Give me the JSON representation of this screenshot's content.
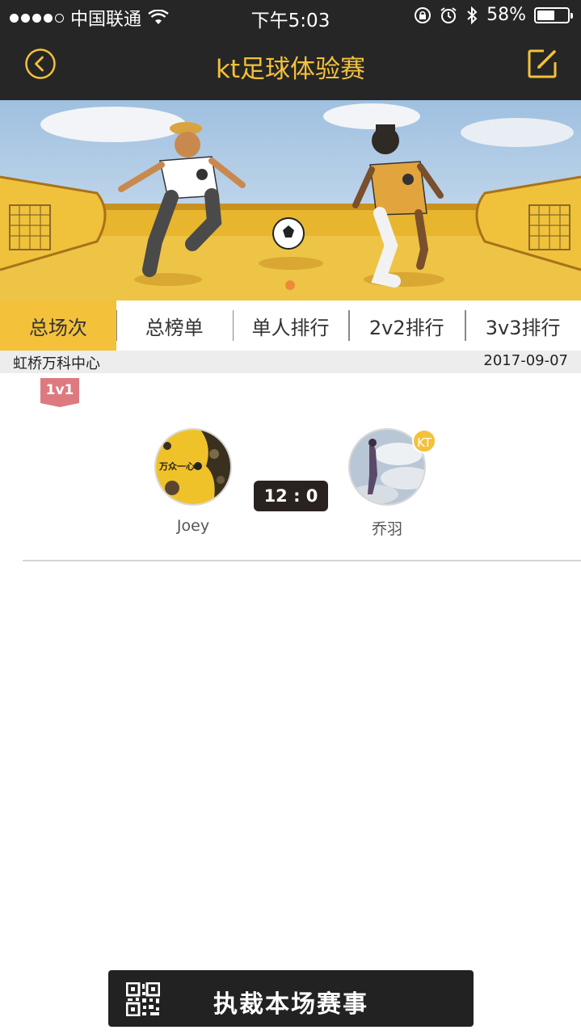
{
  "status_bar": {
    "carrier": "中国联通",
    "time": "下午5:03",
    "battery_percent": "58%",
    "battery_level": 0.58,
    "icons": [
      "signal-dots-icon",
      "wifi-icon",
      "rotation-lock-icon",
      "alarm-icon",
      "bluetooth-icon",
      "battery-icon"
    ]
  },
  "nav": {
    "title": "kt足球体验赛",
    "back_icon": "chevron-left-circle-icon",
    "edit_icon": "edit-icon"
  },
  "banner": {
    "pager_dots": 1,
    "active_dot": 0
  },
  "tabs": [
    {
      "label": "总场次",
      "active": true
    },
    {
      "label": "总榜单",
      "active": false
    },
    {
      "label": "单人排行",
      "active": false
    },
    {
      "label": "2v2排行",
      "active": false
    },
    {
      "label": "3v3排行",
      "active": false
    }
  ],
  "info": {
    "venue": "虹桥万科中心",
    "date": "2017-09-07"
  },
  "match": {
    "mode": "1v1",
    "score": "12 : 0",
    "left_player": {
      "name": "Joey",
      "avatar_text": "万众一心"
    },
    "right_player": {
      "name": "乔羽",
      "badge": "KT"
    }
  },
  "bottom_button": {
    "label": "执裁本场赛事",
    "icon": "qr-code-icon"
  },
  "colors": {
    "accent": "#f3c13a",
    "dark": "#262626",
    "tag": "#dd7a80"
  }
}
